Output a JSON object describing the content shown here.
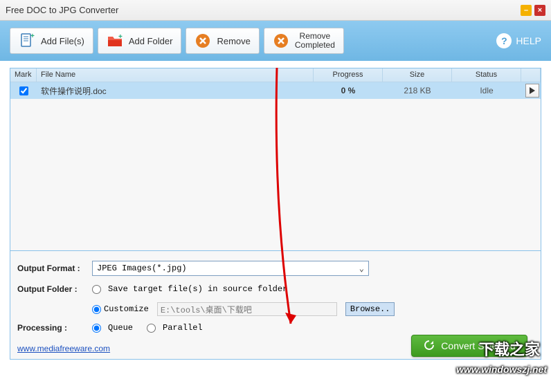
{
  "window": {
    "title": "Free DOC to JPG Converter"
  },
  "toolbar": {
    "add_files": "Add File(s)",
    "add_folder": "Add Folder",
    "remove": "Remove",
    "remove_completed_l1": "Remove",
    "remove_completed_l2": "Completed",
    "help": "HELP"
  },
  "table": {
    "headers": {
      "mark": "Mark",
      "name": "File Name",
      "progress": "Progress",
      "size": "Size",
      "status": "Status"
    },
    "rows": [
      {
        "checked": true,
        "name": "软件操作说明.doc",
        "progress": "0 %",
        "size": "218 KB",
        "status": "Idle"
      }
    ]
  },
  "output": {
    "format_label": "Output Format :",
    "format_value": "JPEG Images(*.jpg)",
    "folder_label": "Output Folder :",
    "save_source": "Save target file(s) in source folder",
    "customize": "Customize",
    "path": "E:\\tools\\桌面\\下载吧",
    "browse": "Browse..",
    "processing_label": "Processing :",
    "queue": "Queue",
    "parallel": "Parallel"
  },
  "convert": "Convert Selected",
  "link": "www.mediafreeware.com",
  "watermark": {
    "cn": "下载之家",
    "url": "www.windowszj.net"
  }
}
